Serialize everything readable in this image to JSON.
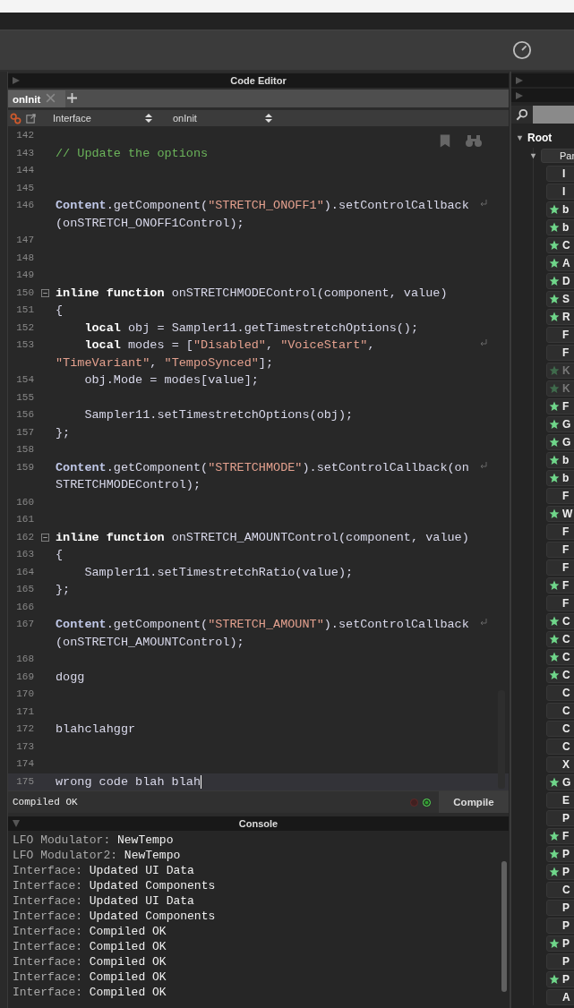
{
  "editor": {
    "title": "Code Editor",
    "tabs": [
      {
        "label": "onInit",
        "selected": true
      }
    ],
    "selectors": [
      "Interface",
      "onInit"
    ],
    "lines": [
      {
        "number": "142"
      },
      {
        "number": "143",
        "rows": [
          [
            {
              "kind": "comment",
              "text": "// Update the options"
            }
          ]
        ]
      },
      {
        "number": "144"
      },
      {
        "number": "145"
      },
      {
        "number": "146",
        "rows": [
          [
            {
              "kind": "object",
              "text": "Content"
            },
            {
              "kind": "plain",
              "text": ".getComponent("
            },
            {
              "kind": "string",
              "text": "\"STRETCH_ONOFF1\""
            },
            {
              "kind": "plain",
              "text": ").setControlCallback"
            }
          ],
          [
            {
              "kind": "plain",
              "text": "(onSTRETCH_ONOFF1Control);"
            }
          ]
        ]
      },
      {
        "number": "147"
      },
      {
        "number": "148"
      },
      {
        "number": "149"
      },
      {
        "number": "150",
        "fold": true,
        "rows": [
          [
            {
              "kind": "keyword",
              "text": "inline function"
            },
            {
              "kind": "plain",
              "text": " onSTRETCHMODEControl(component, value)"
            }
          ]
        ]
      },
      {
        "number": "151",
        "rows": [
          [
            {
              "kind": "plain",
              "text": "{"
            }
          ]
        ]
      },
      {
        "number": "152",
        "rows": [
          [
            {
              "kind": "keyword",
              "text": "    local"
            },
            {
              "kind": "plain",
              "text": " obj = Sampler11.getTimestretchOptions();"
            }
          ]
        ]
      },
      {
        "number": "153",
        "rows": [
          [
            {
              "kind": "keyword",
              "text": "    local"
            },
            {
              "kind": "plain",
              "text": " modes = ["
            },
            {
              "kind": "string",
              "text": "\"Disabled\""
            },
            {
              "kind": "plain",
              "text": ", "
            },
            {
              "kind": "string",
              "text": "\"VoiceStart\""
            },
            {
              "kind": "plain",
              "text": ","
            }
          ],
          [
            {
              "kind": "string",
              "text": "\"TimeVariant\""
            },
            {
              "kind": "plain",
              "text": ", "
            },
            {
              "kind": "string",
              "text": "\"TempoSynced\""
            },
            {
              "kind": "plain",
              "text": "];"
            }
          ]
        ]
      },
      {
        "number": "154",
        "rows": [
          [
            {
              "kind": "plain",
              "text": "    obj.Mode = modes[value];"
            }
          ]
        ]
      },
      {
        "number": "155"
      },
      {
        "number": "156",
        "rows": [
          [
            {
              "kind": "plain",
              "text": "    Sampler11.setTimestretchOptions(obj);"
            }
          ]
        ]
      },
      {
        "number": "157",
        "rows": [
          [
            {
              "kind": "plain",
              "text": "};"
            }
          ]
        ]
      },
      {
        "number": "158"
      },
      {
        "number": "159",
        "rows": [
          [
            {
              "kind": "object",
              "text": "Content"
            },
            {
              "kind": "plain",
              "text": ".getComponent("
            },
            {
              "kind": "string",
              "text": "\"STRETCHMODE\""
            },
            {
              "kind": "plain",
              "text": ").setControlCallback(on"
            }
          ],
          [
            {
              "kind": "plain",
              "text": "STRETCHMODEControl);"
            }
          ]
        ]
      },
      {
        "number": "160"
      },
      {
        "number": "161"
      },
      {
        "number": "162",
        "fold": true,
        "rows": [
          [
            {
              "kind": "keyword",
              "text": "inline function"
            },
            {
              "kind": "plain",
              "text": " onSTRETCH_AMOUNTControl(component, value)"
            }
          ]
        ]
      },
      {
        "number": "163",
        "rows": [
          [
            {
              "kind": "plain",
              "text": "{"
            }
          ]
        ]
      },
      {
        "number": "164",
        "rows": [
          [
            {
              "kind": "plain",
              "text": "    Sampler11.setTimestretchRatio(value);"
            }
          ]
        ]
      },
      {
        "number": "165",
        "rows": [
          [
            {
              "kind": "plain",
              "text": "};"
            }
          ]
        ]
      },
      {
        "number": "166"
      },
      {
        "number": "167",
        "rows": [
          [
            {
              "kind": "object",
              "text": "Content"
            },
            {
              "kind": "plain",
              "text": ".getComponent("
            },
            {
              "kind": "string",
              "text": "\"STRETCH_AMOUNT\""
            },
            {
              "kind": "plain",
              "text": ").setControlCallback"
            }
          ],
          [
            {
              "kind": "plain",
              "text": "(onSTRETCH_AMOUNTControl);"
            }
          ]
        ]
      },
      {
        "number": "168"
      },
      {
        "number": "169",
        "rows": [
          [
            {
              "kind": "plain",
              "text": "dogg"
            }
          ]
        ]
      },
      {
        "number": "170"
      },
      {
        "number": "171"
      },
      {
        "number": "172",
        "rows": [
          [
            {
              "kind": "plain",
              "text": "blahclahggr"
            }
          ]
        ]
      },
      {
        "number": "173"
      },
      {
        "number": "174"
      },
      {
        "number": "175",
        "active": true,
        "rows": [
          [
            {
              "kind": "plain",
              "text": "wrong code blah blah"
            }
          ]
        ]
      }
    ],
    "status": "Compiled OK",
    "lights": [
      {
        "kind": "error",
        "on": false
      },
      {
        "kind": "ok",
        "on": true
      }
    ],
    "compile_button": "Compile"
  },
  "console": {
    "title": "Console",
    "lines": [
      {
        "source": "LFO Modulator:",
        "message": "NewTempo"
      },
      {
        "source": "LFO Modulator2:",
        "message": "NewTempo"
      },
      {
        "source": "Interface:",
        "message": "Updated UI Data"
      },
      {
        "source": "Interface:",
        "message": "Updated Components"
      },
      {
        "source": "Interface:",
        "message": "Updated UI Data"
      },
      {
        "source": "Interface:",
        "message": "Updated Components"
      },
      {
        "source": "Interface:",
        "message": "Compiled OK"
      },
      {
        "source": "Interface:",
        "message": "Compiled OK"
      },
      {
        "source": "Interface:",
        "message": "Compiled OK"
      },
      {
        "source": "Interface:",
        "message": "Compiled OK"
      },
      {
        "source": "Interface:",
        "message": "Compiled OK"
      }
    ]
  },
  "tree": {
    "label": "Root",
    "expanded": true,
    "children": [
      {
        "label": "Par",
        "expanded": true,
        "children": [
          {
            "label": "I",
            "starred": false,
            "disabled": false
          },
          {
            "label": "I",
            "starred": false,
            "disabled": false
          },
          {
            "label": "b",
            "starred": true,
            "disabled": false
          },
          {
            "label": "b",
            "starred": true,
            "disabled": false
          },
          {
            "label": "C",
            "starred": true,
            "disabled": false
          },
          {
            "label": "A",
            "starred": true,
            "disabled": false
          },
          {
            "label": "D",
            "starred": true,
            "disabled": false
          },
          {
            "label": "S",
            "starred": true,
            "disabled": false
          },
          {
            "label": "R",
            "starred": true,
            "disabled": false
          },
          {
            "label": "F",
            "starred": false,
            "disabled": false
          },
          {
            "label": "F",
            "starred": false,
            "disabled": false
          },
          {
            "label": "K",
            "starred": true,
            "disabled": true
          },
          {
            "label": "K",
            "starred": true,
            "disabled": true
          },
          {
            "label": "F",
            "starred": true,
            "disabled": false
          },
          {
            "label": "G",
            "starred": true,
            "disabled": false
          },
          {
            "label": "G",
            "starred": true,
            "disabled": false
          },
          {
            "label": "b",
            "starred": true,
            "disabled": false
          },
          {
            "label": "b",
            "starred": true,
            "disabled": false
          },
          {
            "label": "F",
            "starred": false,
            "disabled": false
          },
          {
            "label": "W",
            "starred": true,
            "disabled": false
          },
          {
            "label": "F",
            "starred": false,
            "disabled": false
          },
          {
            "label": "F",
            "starred": false,
            "disabled": false
          },
          {
            "label": "F",
            "starred": false,
            "disabled": false
          },
          {
            "label": "F",
            "starred": true,
            "disabled": false
          },
          {
            "label": "F",
            "starred": false,
            "disabled": false
          },
          {
            "label": "C",
            "starred": true,
            "disabled": false
          },
          {
            "label": "C",
            "starred": true,
            "disabled": false
          },
          {
            "label": "C",
            "starred": true,
            "disabled": false
          },
          {
            "label": "C",
            "starred": true,
            "disabled": false
          },
          {
            "label": "C",
            "starred": false,
            "disabled": false
          },
          {
            "label": "C",
            "starred": false,
            "disabled": false
          },
          {
            "label": "C",
            "starred": false,
            "disabled": false
          },
          {
            "label": "C",
            "starred": false,
            "disabled": false
          },
          {
            "label": "X",
            "starred": false,
            "disabled": false
          },
          {
            "label": "G",
            "starred": true,
            "disabled": false
          },
          {
            "label": "E",
            "starred": false,
            "disabled": false
          },
          {
            "label": "P",
            "starred": false,
            "disabled": false
          },
          {
            "label": "F",
            "starred": true,
            "disabled": false
          },
          {
            "label": "P",
            "starred": true,
            "disabled": false
          },
          {
            "label": "P",
            "starred": true,
            "disabled": false
          },
          {
            "label": "C",
            "starred": false,
            "disabled": false
          },
          {
            "label": "P",
            "starred": false,
            "disabled": false
          },
          {
            "label": "P",
            "starred": false,
            "disabled": false
          },
          {
            "label": "P",
            "starred": true,
            "disabled": false
          },
          {
            "label": "P",
            "starred": false,
            "disabled": false
          },
          {
            "label": "P",
            "starred": true,
            "disabled": false
          },
          {
            "label": "A",
            "starred": false,
            "disabled": false
          }
        ]
      }
    ]
  }
}
